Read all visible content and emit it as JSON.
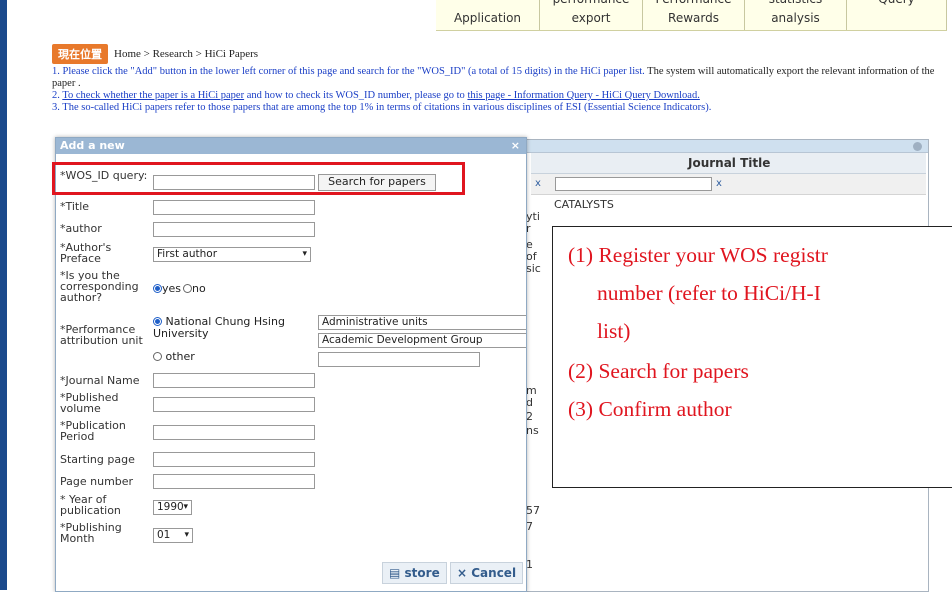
{
  "topnav": {
    "tabs": [
      {
        "cut": "",
        "label": "Application",
        "w": 104
      },
      {
        "cut": "performance",
        "label": "export",
        "w": 103
      },
      {
        "cut": "Performance",
        "label": "Rewards",
        "w": 102
      },
      {
        "cut": "statistics",
        "label": "analysis",
        "w": 102
      },
      {
        "cut": "Query",
        "label": "",
        "w": 100
      }
    ]
  },
  "breadcrumb": {
    "badge": "現在位置",
    "path": "Home > Research > HiCi Papers"
  },
  "notes": {
    "line1a": "1. Please click the \"Add\" button in the lower left corner of this page and search for the \"WOS_ID\" (a total of 15 digits) in the HiCi paper list.",
    "line1b": " The system will automatically export the relevant information of the paper .",
    "line2_prefix": "2. ",
    "line2_link1": "To check whether the paper is a HiCi paper",
    "line2_mid": " and how to check its WOS_ID number, please go to ",
    "line2_link2": "this page - Information Query - HiCi Query Download.",
    "line3": "3. The so-called HiCi papers refer to those papers that are among the top 1% in terms of citations in various disciplines of ESI (Essential Science Indicators)."
  },
  "grid": {
    "header_journal": "Journal Title",
    "filter_clear": "x",
    "row1_journal": "CATALYSTS",
    "partial_left": [
      "x",
      "yti",
      "r",
      "e",
      "of",
      "sic",
      "m",
      "d",
      "2",
      "ns",
      "57",
      "7",
      "1"
    ]
  },
  "modal": {
    "title": "Add a new",
    "close": "×",
    "fields": {
      "wos_label": "*WOS_ID query:",
      "search_button": "Search for papers",
      "title_label": "*Title",
      "author_label": "*author",
      "preface_label": "*Author's Preface",
      "preface_value": "First author",
      "corresponding_label": "*Is you the corresponding author?",
      "yes": "yes",
      "no": "no",
      "perf_label": "*Performance attribution unit",
      "nchu": "National Chung Hsing University",
      "other": "other",
      "admin_units": "Administrative units",
      "academic_group": "Academic Development Group",
      "journal_label": "*Journal Name",
      "volume_label": "*Published volume",
      "period_label": "*Publication Period",
      "start_label": "Starting page",
      "pagenum_label": "Page number",
      "year_label": "* Year of publication",
      "year_value": "1990",
      "month_label": "*Publishing Month",
      "month_value": "01"
    },
    "store": "store",
    "cancel": "Cancel"
  },
  "callout": {
    "lines": [
      "(1) Register your WOS registr",
      "number (refer to HiCi/H-I",
      "list)",
      "(2) Search for papers",
      "(3) Confirm author"
    ]
  }
}
